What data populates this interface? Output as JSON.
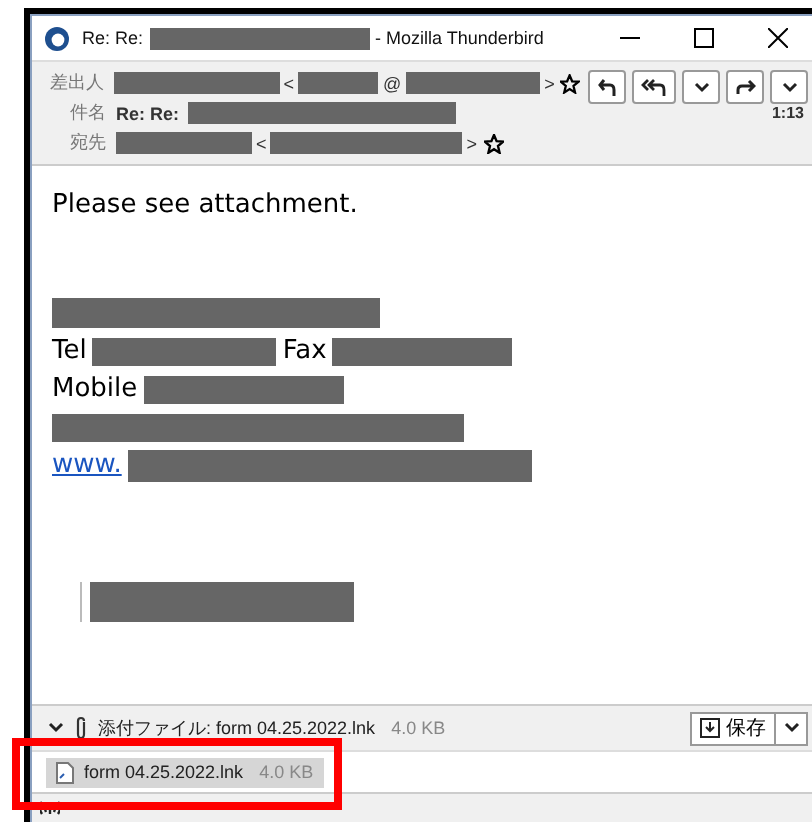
{
  "window": {
    "title_prefix": "Re: Re:",
    "title_suffix": "- Mozilla Thunderbird"
  },
  "header": {
    "from": {
      "label": "差出人",
      "open": "<",
      "at": "@",
      "close": ">"
    },
    "subject": {
      "label": "件名",
      "value": "Re: Re:",
      "time": "1:13"
    },
    "to": {
      "label": "宛先",
      "open": "<",
      "close": ">"
    }
  },
  "body": {
    "greeting": "Please see attachment.",
    "tel": "Tel",
    "fax": "Fax",
    "mobile": "Mobile",
    "link": "www."
  },
  "attachment_bar": {
    "label": "添付ファイル: form 04.25.2022.lnk",
    "size": "4.0 KB",
    "save": "保存"
  },
  "attachments": [
    {
      "name": "form 04.25.2022.lnk",
      "size": "4.0 KB",
      "selected": true,
      "highlighted": true
    }
  ]
}
